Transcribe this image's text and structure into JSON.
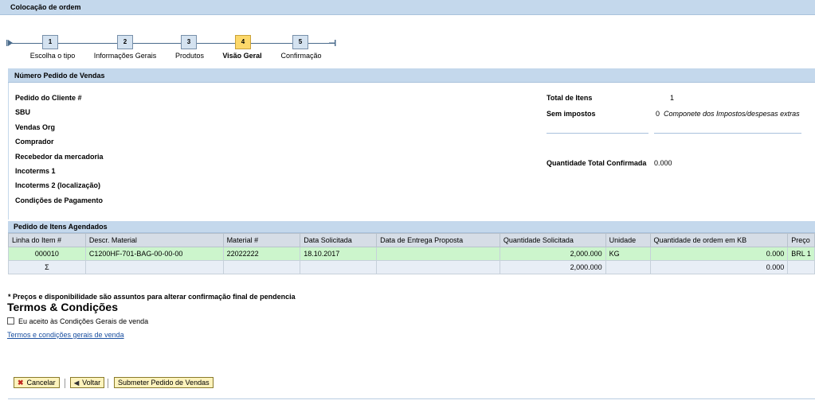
{
  "title": "Colocação de ordem",
  "roadmap": {
    "steps": [
      {
        "num": "1",
        "label": "Escolha o tipo"
      },
      {
        "num": "2",
        "label": "Informações Gerais"
      },
      {
        "num": "3",
        "label": "Produtos"
      },
      {
        "num": "4",
        "label": "Visão Geral"
      },
      {
        "num": "5",
        "label": "Confirmação"
      }
    ],
    "active_step": "4"
  },
  "header_section": {
    "title": "Número Pedido de Vendas",
    "fields_left": [
      {
        "label": "Pedido do Cliente #",
        "value": ""
      },
      {
        "label": "SBU",
        "value": ""
      },
      {
        "label": "Vendas Org",
        "value": ""
      },
      {
        "label": "Comprador",
        "value": ""
      },
      {
        "label": "Recebedor da mercadoria",
        "value": ""
      },
      {
        "label": "Incoterms 1",
        "value": ""
      },
      {
        "label": "Incoterms 2 (localização)",
        "value": ""
      },
      {
        "label": "Condições de Pagamento",
        "value": ""
      }
    ],
    "total_itens_label": "Total de Itens",
    "total_itens_value": "1",
    "sem_impostos_label": "Sem impostos",
    "sem_impostos_value": "0",
    "sem_impostos_note": "Componete dos Impostos/despesas extras",
    "qtd_total_label": "Quantidade Total Confirmada",
    "qtd_total_value": "0.000"
  },
  "items_section": {
    "title": "Pedido de Itens Agendados",
    "columns": [
      "Linha do Item #",
      "Descr. Material",
      "Material #",
      "Data Solicitada",
      "Data de Entrega Proposta",
      "Quantidade Solicitada",
      "Unidade",
      "Quantidade de ordem em KB",
      "Preço"
    ],
    "rows": [
      {
        "linha": "000010",
        "descr": "C1200HF-701-BAG-00-00-00",
        "material": "22022222",
        "data_sol": "18.10.2017",
        "data_entrega": "",
        "qtd_sol": "2,000.000",
        "unidade": "KG",
        "qtd_kb": "0.000",
        "preco": "BRL 1"
      }
    ],
    "total_row": {
      "symbol": "Σ",
      "qtd_sol": "2,000.000",
      "qtd_kb": "0.000"
    }
  },
  "disclaimer": "* Preços e disponibilidade são assuntos para alterar confirmação final de pendencia",
  "terms": {
    "heading": "Termos & Condições",
    "checkbox_label": "Eu aceito às Condições Gerais de venda",
    "link_text": "Termos e condições gerais de venda"
  },
  "buttons": {
    "cancel": "Cancelar",
    "back": "Voltar",
    "submit": "Submeter Pedido de Vendas"
  },
  "colors": {
    "header_bar": "#c4d8ec",
    "active_step": "#fcd86a",
    "selected_row": "#ccf5cc",
    "button_bg": "#fdf3bd"
  }
}
